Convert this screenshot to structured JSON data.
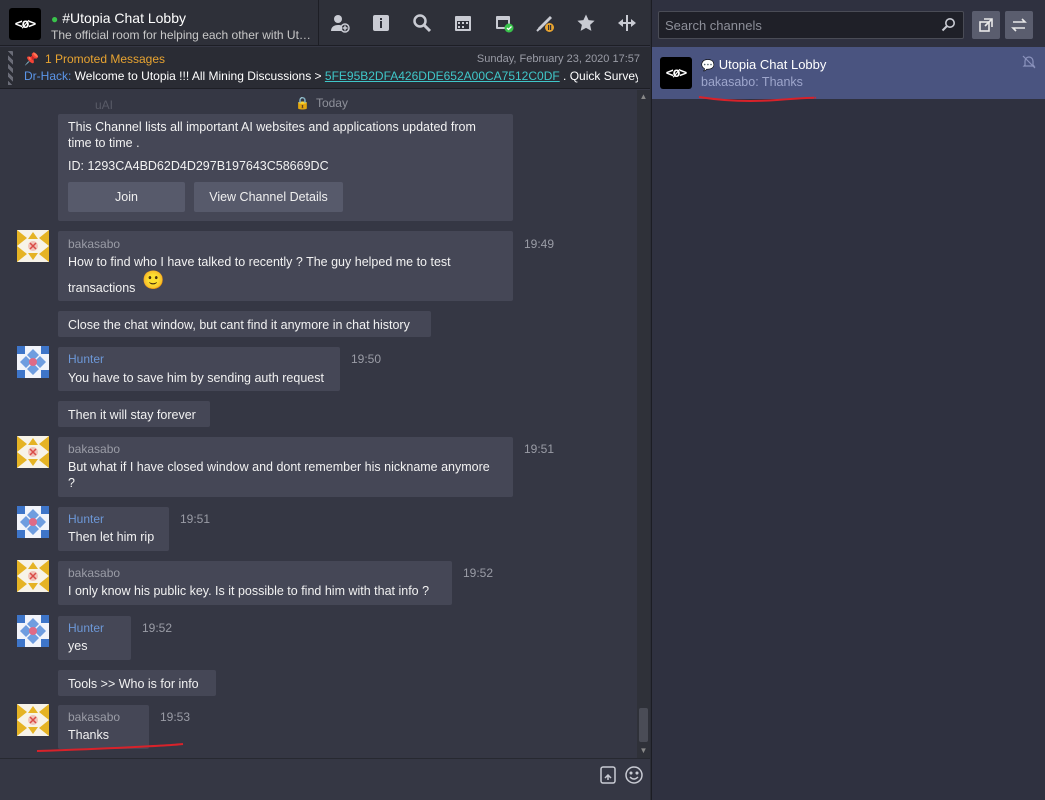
{
  "channel": {
    "logo_text": "<ø>",
    "title": "#Utopia Chat Lobby",
    "subtitle": "The official room for helping each other with Utopia"
  },
  "toolbar": {
    "icons": [
      "add-contact-icon",
      "info-icon",
      "search-icon",
      "calendar-icon",
      "record-calendar-icon",
      "promote-icon",
      "star-icon",
      "resize-icon"
    ]
  },
  "promo": {
    "count_label": "1 Promoted Messages",
    "date": "Sunday, February 23, 2020 17:57",
    "author": "Dr-Hack:",
    "text_before": " Welcome to Utopia !!! All Mining Discussions > ",
    "link": "5FE95B2DFA426DDE652A00CA7512C0DF",
    "text_after": " . Quick Survey about Utopia"
  },
  "chat": {
    "day_label": "Today",
    "faded_name": "uAI",
    "card": {
      "description": "This Channel lists all important AI websites and applications updated from time to time .",
      "id_line": "ID: 1293CA4BD62D4D297B197643C58669DC",
      "join_label": "Join",
      "details_label": "View Channel Details"
    },
    "messages": [
      {
        "name": "bakasabo",
        "time": "19:49",
        "lines": [
          "How to find who I have talked to recently ? The guy helped me to test",
          "transactions"
        ],
        "emoji": "🙂"
      },
      {
        "lines": [
          "Close the chat window, but cant find it anymore in chat history"
        ]
      },
      {
        "name": "Hunter",
        "time": "19:50",
        "lines": [
          "You have to save him by sending auth request"
        ]
      },
      {
        "lines": [
          "Then it will stay forever"
        ]
      },
      {
        "name": "bakasabo",
        "time": "19:51",
        "lines": [
          "But what if I have closed window and dont remember his nickname anymore",
          "?"
        ]
      },
      {
        "name": "Hunter",
        "time": "19:51",
        "lines": [
          "Then let him rip"
        ]
      },
      {
        "name": "bakasabo",
        "time": "19:52",
        "lines": [
          "I only know his public key. Is it possible to find him with that info ?"
        ]
      },
      {
        "name": "Hunter",
        "time": "19:52",
        "lines": [
          "yes"
        ]
      },
      {
        "lines": [
          "Tools >> Who is for info"
        ]
      },
      {
        "name": "bakasabo",
        "time": "19:53",
        "lines": [
          "Thanks"
        ]
      }
    ]
  },
  "sidebar": {
    "search_placeholder": "Search channels",
    "channels": [
      {
        "logo_text": "<ø>",
        "title": "Utopia Chat Lobby",
        "last_message": "bakasabo: Thanks"
      }
    ]
  },
  "colors": {
    "accent_red_underline": "#d8222a",
    "selected_channel": "#4a5480",
    "hunter_name": "#6d98d8",
    "promo_orange": "#e8a431",
    "link_cyan": "#3fc7c9"
  }
}
